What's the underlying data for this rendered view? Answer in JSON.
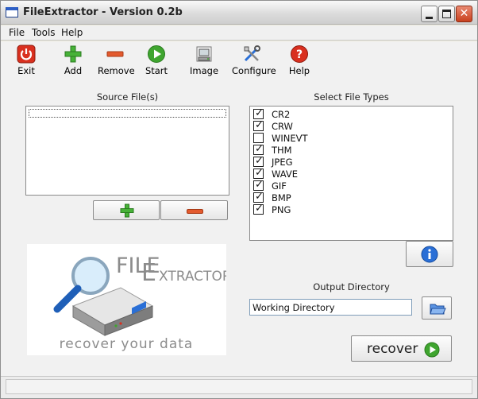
{
  "window": {
    "title": "FileExtractor - Version 0.2b"
  },
  "menu": {
    "items": [
      "File",
      "Tools",
      "Help"
    ]
  },
  "toolbar": {
    "buttons": [
      {
        "label": "Exit",
        "icon": "power-icon"
      },
      {
        "label": "Add",
        "icon": "plus-icon"
      },
      {
        "label": "Remove",
        "icon": "minus-icon"
      },
      {
        "label": "Start",
        "icon": "play-icon"
      },
      {
        "label": "Image",
        "icon": "disk-image-icon"
      },
      {
        "label": "Configure",
        "icon": "tools-icon"
      },
      {
        "label": "Help",
        "icon": "help-icon"
      }
    ]
  },
  "source": {
    "label": "Source File(s)",
    "files": []
  },
  "filetypes": {
    "label": "Select File Types",
    "items": [
      {
        "name": "CR2",
        "checked": true
      },
      {
        "name": "CRW",
        "checked": true
      },
      {
        "name": "WINEVT",
        "checked": false
      },
      {
        "name": "THM",
        "checked": true
      },
      {
        "name": "JPEG",
        "checked": true
      },
      {
        "name": "WAVE",
        "checked": true
      },
      {
        "name": "GIF",
        "checked": true
      },
      {
        "name": "BMP",
        "checked": true
      },
      {
        "name": "PNG",
        "checked": true
      }
    ]
  },
  "logo": {
    "brand_line1": "FILE",
    "brand_line2": "XTRACTOR",
    "tagline": "recover your data"
  },
  "output": {
    "label": "Output Directory",
    "value": "Working Directory"
  },
  "recover_button": {
    "label": "recover"
  },
  "colors": {
    "green": "#3fa52f",
    "red": "#e35a2e",
    "blue": "#2a6fd6"
  }
}
